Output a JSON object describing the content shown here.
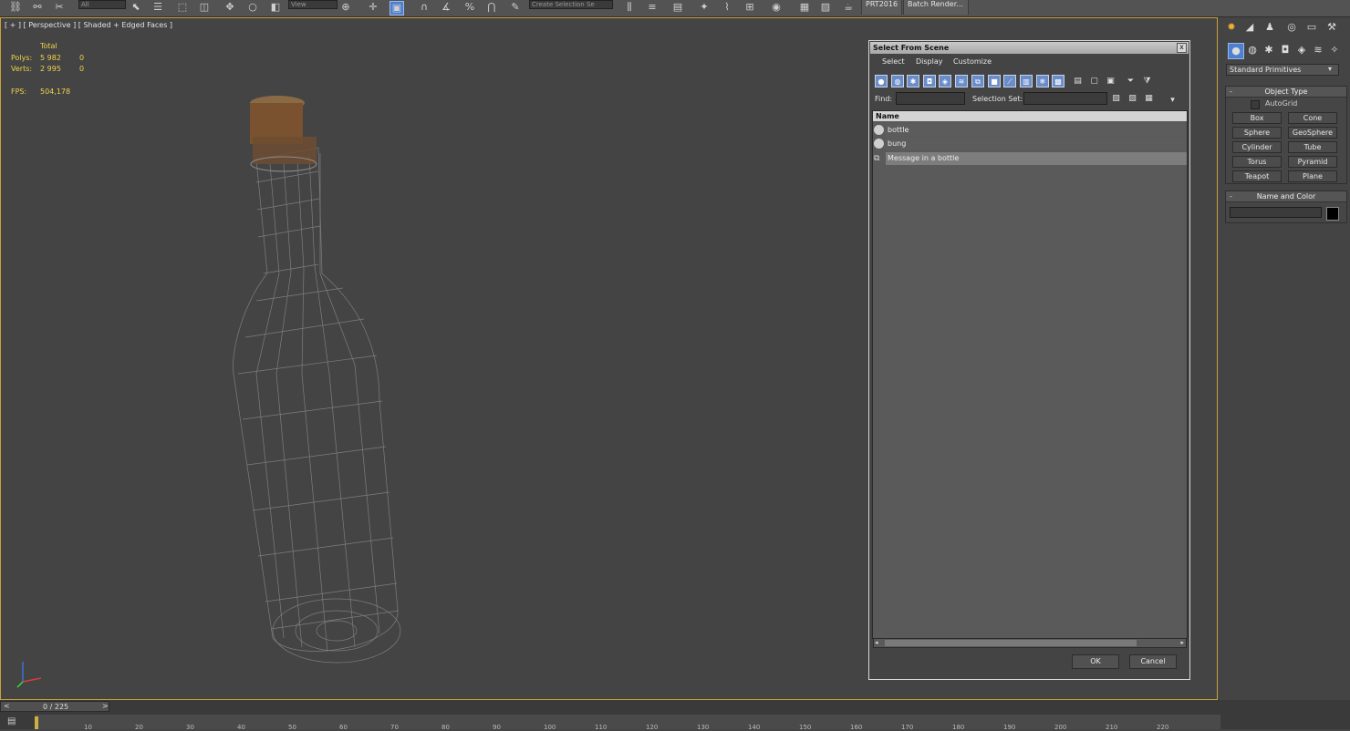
{
  "toolbar": {
    "combo_filter": "All",
    "combo_view": "View",
    "combo_selection_set": "Create Selection Se",
    "prt_label": "PRT2016",
    "batch_render_label": "Batch Render..."
  },
  "viewport": {
    "label": "[ + ] [ Perspective ] [ Shaded + Edged Faces ]",
    "stats_header": "Total",
    "polys_label": "Polys:",
    "polys_total": "5 982",
    "polys_sel": "0",
    "verts_label": "Verts:",
    "verts_total": "2 995",
    "verts_sel": "0",
    "fps_label": "FPS:",
    "fps_value": "504,178"
  },
  "dialog": {
    "title": "Select From Scene",
    "close": "x",
    "menu": [
      "Select",
      "Display",
      "Customize"
    ],
    "find_label": "Find:",
    "find_value": "",
    "selection_set_label": "Selection Set:",
    "selection_set_value": "",
    "list_header": "Name",
    "rows": [
      {
        "name": "bottle",
        "icon": "sphere-icon"
      },
      {
        "name": "bung",
        "icon": "sphere-icon"
      },
      {
        "name": "Message in a bottle",
        "icon": "group-icon",
        "selected": true
      }
    ],
    "ok": "OK",
    "cancel": "Cancel"
  },
  "command_panel": {
    "category": "Standard Primitives",
    "object_type_title": "Object Type",
    "autogrid": "AutoGrid",
    "primitives": [
      "Box",
      "Cone",
      "Sphere",
      "GeoSphere",
      "Cylinder",
      "Tube",
      "Torus",
      "Pyramid",
      "Teapot",
      "Plane"
    ],
    "name_color_title": "Name and Color",
    "name_value": "",
    "swatch_color": "#000000"
  },
  "timeline": {
    "frame_label": "0 / 225",
    "ticks": [
      "10",
      "20",
      "30",
      "40",
      "50",
      "60",
      "70",
      "80",
      "90",
      "100",
      "110",
      "120",
      "130",
      "140",
      "150",
      "160",
      "170",
      "180",
      "190",
      "200",
      "210",
      "220"
    ]
  },
  "colors": {
    "viewport_border": "#c8a23a",
    "stats_text": "#f0d24a",
    "selected_row": "#7d7d7d"
  }
}
